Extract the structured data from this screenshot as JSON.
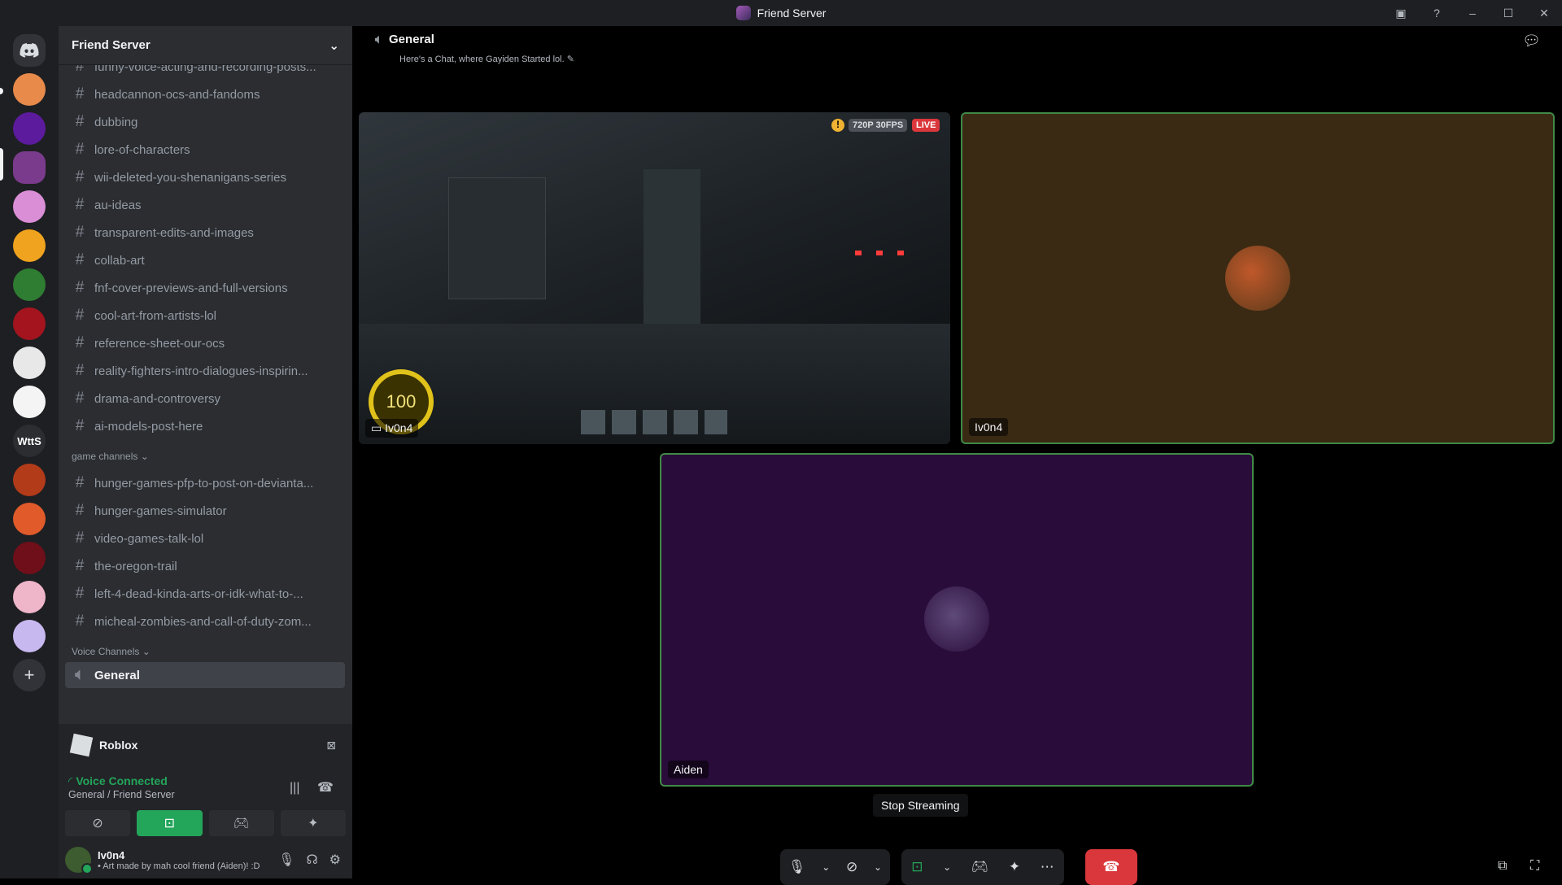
{
  "window": {
    "title": "Friend Server",
    "min": "–",
    "max": "☐",
    "close": "✕",
    "inbox_icon": "▣",
    "help_icon": "?"
  },
  "guilds": {
    "home_icon": "discord-logo",
    "wtts_label": "WttS",
    "add_label": "+"
  },
  "sidebar": {
    "server_name": "Friend Server",
    "channels_top": [
      "funny-voice-acting-and-recording-posts...",
      "headcannon-ocs-and-fandoms",
      "dubbing",
      "lore-of-characters",
      "wii-deleted-you-shenanigans-series",
      "au-ideas",
      "transparent-edits-and-images",
      "collab-art",
      "fnf-cover-previews-and-full-versions",
      "cool-art-from-artists-lol",
      "reference-sheet-our-ocs",
      "reality-fighters-intro-dialogues-inspirin...",
      "drama-and-controversy",
      "ai-models-post-here"
    ],
    "category_game": "game channels ⌄",
    "channels_game": [
      "hunger-games-pfp-to-post-on-devianta...",
      "hunger-games-simulator",
      "video-games-talk-lol",
      "the-oregon-trail",
      "left-4-dead-kinda-arts-or-idk-what-to-...",
      "micheal-zombies-and-call-of-duty-zom..."
    ],
    "category_voice": "Voice Channels ⌄",
    "voice_channel": "General",
    "hash": "#"
  },
  "panel": {
    "activity": "Roblox",
    "voice_status": "Voice Connected",
    "voice_location": "General / Friend Server",
    "username": "Iv0n4",
    "user_status": "• Art made by mah cool friend (Aiden)! :D"
  },
  "stage": {
    "channel_title": "General",
    "channel_topic": "Here's a Chat, where Gayiden Started lol.",
    "stream": {
      "quality": "720P 30FPS",
      "live": "LIVE",
      "owner": "Iv0n4",
      "hud_value": "100"
    },
    "tile_user": "Iv0n4",
    "tile_aiden": "Aiden",
    "tooltip": "Stop Streaming"
  },
  "colors": {
    "accent_green": "#23a55a",
    "danger": "#da373c",
    "tile_brown": "#3a2a14",
    "tile_purple": "#2a0c3a"
  }
}
